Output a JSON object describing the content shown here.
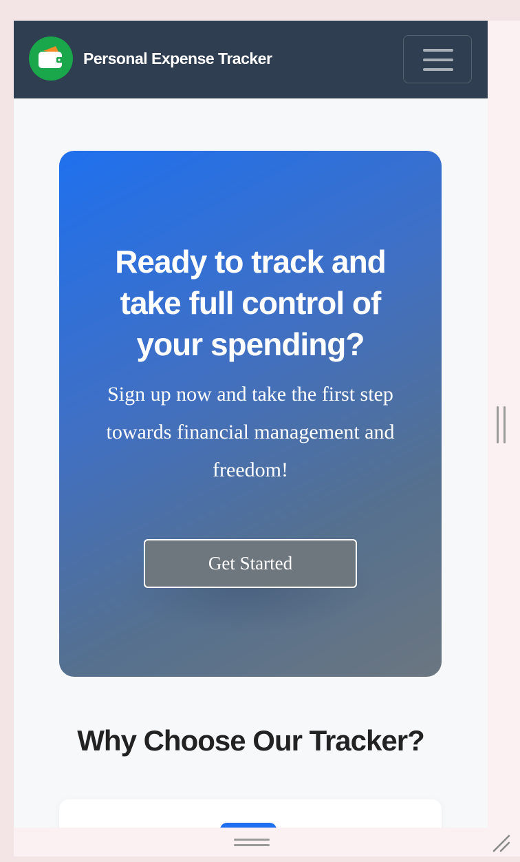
{
  "navbar": {
    "brand": "Personal Expense Tracker",
    "logo_icon": "wallet-icon",
    "menu_icon": "hamburger-menu-icon"
  },
  "hero": {
    "title": "Ready to track and take full control of your spending?",
    "text": "Sign up now and take the first step towards financial management and freedom!",
    "cta_label": "Get Started"
  },
  "features": {
    "title": "Why Choose Our Tracker?"
  },
  "colors": {
    "navbar_bg": "#2f3e50",
    "brand_green": "#1aa64a",
    "hero_start": "#1f70ee",
    "hero_end": "#6b7680",
    "accent_blue": "#1f6ff0"
  }
}
